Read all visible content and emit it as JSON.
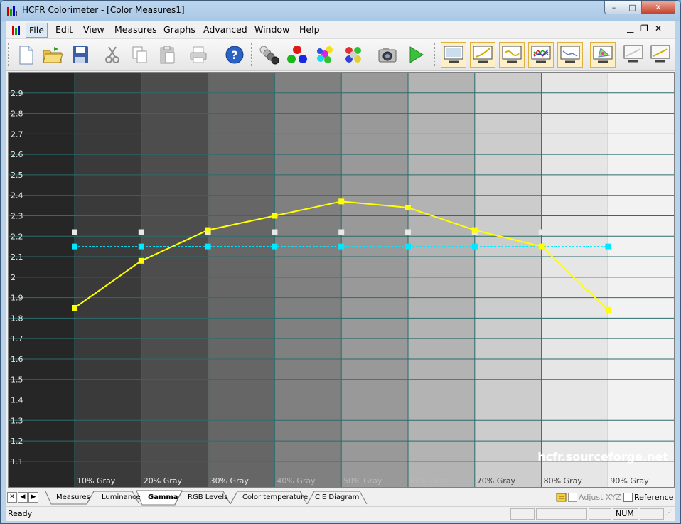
{
  "window": {
    "title": "HCFR Colorimeter - [Color Measures1]"
  },
  "menu": [
    "File",
    "Edit",
    "View",
    "Measures",
    "Graphs",
    "Advanced",
    "Window",
    "Help"
  ],
  "toolbar_icons": [
    "new-document-icon",
    "open-folder-icon",
    "save-disk-icon",
    "cut-scissors-icon",
    "copy-icon",
    "paste-icon",
    "print-icon",
    "help-icon",
    "gray-sequence-icon",
    "primary-colors-icon",
    "secondary-colors-icon",
    "color-mix-icon",
    "camera-icon",
    "play-measure-icon",
    "view-monitor-icon",
    "view-gamma-curve-icon",
    "view-luminance-icon",
    "view-rgb-levels-icon",
    "view-color-temp-icon",
    "view-cie-diagram-icon",
    "view-monitor-2-icon",
    "view-monitor-3-icon"
  ],
  "graph": {
    "watermark": "hcfr.sourceforge.net",
    "background_grays": [
      "#262626",
      "#3a3a3a",
      "#4d4d4d",
      "#666666",
      "#808080",
      "#999999",
      "#b3b3b3",
      "#cccccc",
      "#e6e6e6",
      "#f2f2f2"
    ],
    "grid_color": "#2e6b6b",
    "measured_color": "#ffff00",
    "white_line_color": "#e8e8e8",
    "cyan_line_color": "#00e8ff"
  },
  "chart_data": {
    "type": "line",
    "x": [
      "10% Gray",
      "20% Gray",
      "30% Gray",
      "40% Gray",
      "50% Gray",
      "60% Gray",
      "70% Gray",
      "80% Gray",
      "90% Gray"
    ],
    "ylim": [
      1.03,
      3.0
    ],
    "yticks": [
      "1.1",
      "1.2",
      "1.3",
      "1.4",
      "1.5",
      "1.6",
      "1.7",
      "1.8",
      "1.9",
      "2",
      "2.1",
      "2.2",
      "2.3",
      "2.4",
      "2.5",
      "2.6",
      "2.7",
      "2.8",
      "2.9"
    ],
    "grid": true,
    "series": [
      {
        "values": [
          1.85,
          2.08,
          2.23,
          2.3,
          2.37,
          2.34,
          2.23,
          2.15,
          1.84
        ],
        "style": "solid",
        "color": "#ffff00"
      },
      {
        "values": [
          2.22,
          2.22,
          2.22,
          2.22,
          2.22,
          2.22,
          2.22,
          2.22
        ],
        "style": "dashed",
        "color": "#e8e8e8"
      },
      {
        "values": [
          2.15,
          2.15,
          2.15,
          2.15,
          2.15,
          2.15,
          2.15,
          2.15,
          2.15
        ],
        "style": "dashed",
        "color": "#00e8ff"
      }
    ]
  },
  "tabs": [
    "Measures",
    "Luminance",
    "Gamma",
    "RGB Levels",
    "Color temperature",
    "CIE Diagram"
  ],
  "active_tab": "Gamma",
  "options": {
    "adjust_xyz": "Adjust XYZ",
    "reference": "Reference"
  },
  "status": {
    "text": "Ready",
    "num": "NUM"
  }
}
